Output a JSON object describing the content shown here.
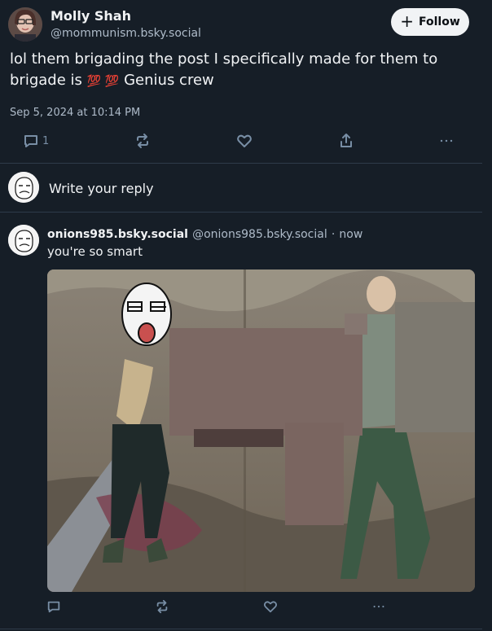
{
  "post": {
    "author_name": "Molly Shah",
    "author_handle": "@mommunism.bsky.social",
    "follow_label": "Follow",
    "text_line1": "lol them brigading the post I specifically made for them to",
    "text_line2_prefix": "brigade is",
    "text_line2_emoji": "💯 💯",
    "text_line2_suffix": "Genius crew",
    "timestamp": "Sep 5, 2024 at 10:14 PM",
    "reply_count": "1",
    "icons": [
      "reply-icon",
      "repost-icon",
      "like-icon",
      "share-icon",
      "more-icon"
    ]
  },
  "composer": {
    "placeholder": "Write your reply"
  },
  "reply": {
    "author_name": "onions985.bsky.social",
    "author_handle": "@onions985.bsky.social",
    "separator": "·",
    "time": "now",
    "text": "you're so smart"
  },
  "colors": {
    "background": "#161e27",
    "text": "#f1f3f5",
    "muted": "#aebbc9",
    "icon": "#788ea5",
    "divider": "#2e3b4a"
  }
}
